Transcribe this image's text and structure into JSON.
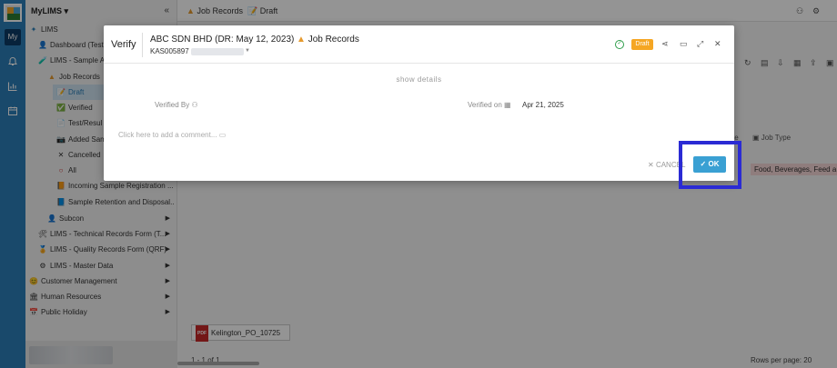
{
  "rail": {
    "my_label": "My"
  },
  "sidebar": {
    "app_name": "MyLIMS",
    "items": [
      {
        "label": "LIMS",
        "icon": "✦"
      },
      {
        "label": "Dashboard (Testi",
        "icon": "👤"
      },
      {
        "label": "LIMS - Sample Ac",
        "icon": "🧪"
      },
      {
        "label": "Job Records",
        "icon": "▲"
      },
      {
        "label": "Draft",
        "icon": "📝"
      },
      {
        "label": "Verified",
        "icon": "✅"
      },
      {
        "label": "Test/Resul",
        "icon": "📄"
      },
      {
        "label": "Added Sam",
        "icon": "📷"
      },
      {
        "label": "Cancelled",
        "icon": "✕"
      },
      {
        "label": "All",
        "icon": "○"
      },
      {
        "label": "Incoming Sample Registration ...",
        "icon": "📙"
      },
      {
        "label": "Sample Retention and Disposal...",
        "icon": "📘"
      },
      {
        "label": "Subcon",
        "icon": "👤"
      },
      {
        "label": "LIMS - Technical Records Form (T...",
        "icon": "🛠"
      },
      {
        "label": "LIMS - Quality Records Form (QRF)",
        "icon": "🏅"
      },
      {
        "label": "LIMS - Master Data",
        "icon": "⚙"
      },
      {
        "label": "Customer Management",
        "icon": "😊"
      },
      {
        "label": "Human Resources",
        "icon": "🏛"
      },
      {
        "label": "Public Holiday",
        "icon": "📅"
      }
    ]
  },
  "main": {
    "breadcrumb": [
      "Job Records",
      "Draft"
    ],
    "col_job_type": "Job Type",
    "col_partial": "te",
    "tag_text": "Food, Beverages, Feed a",
    "attachment": "Kelington_PO_10725",
    "attachment_badge": "PDF",
    "pager": "1 - 1 of 1",
    "pager_right": "Rows per page:",
    "page_size": "20"
  },
  "dialog": {
    "title": "Verify",
    "company": "ABC SDN BHD (DR: May 12, 2023)",
    "record_type": "Job Records",
    "code": "KAS005897",
    "status_badge": "Draft",
    "show_details": "show details",
    "verified_by_label": "Verified By",
    "verified_on_label": "Verified on",
    "verified_on_value": "Apr 21, 2025",
    "comment_placeholder": "Click here to add a comment...",
    "cancel_label": "CANCEL",
    "ok_label": "OK"
  }
}
